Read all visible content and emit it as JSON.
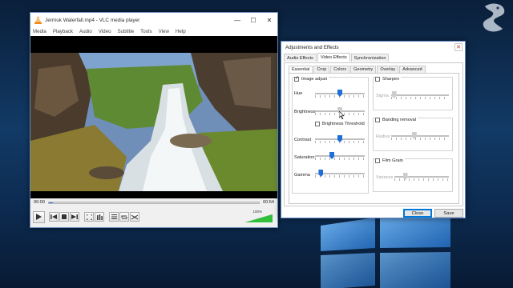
{
  "vlc": {
    "title": "Jermuk Waterfall.mp4 - VLC media player",
    "window_buttons": [
      "—",
      "☐",
      "✕"
    ],
    "menu": [
      "Media",
      "Playback",
      "Audio",
      "Video",
      "Subtitle",
      "Tools",
      "View",
      "Help"
    ],
    "time_elapsed": "00:00",
    "time_total": "00:54",
    "seek_progress": 0.02,
    "volume_label": "100%",
    "volume_level": 1.0
  },
  "adjust": {
    "title": "Adjustments and Effects",
    "close": "✕",
    "tabs": [
      "Audio Effects",
      "Video Effects",
      "Synchronization"
    ],
    "active_tab": "Video Effects",
    "subtabs": [
      "Essential",
      "Crop",
      "Colors",
      "Geometry",
      "Overlay",
      "Advanced"
    ],
    "active_subtab": "Essential",
    "image_adjust": {
      "label": "Image adjust",
      "checked": true
    },
    "hue": {
      "label": "Hue",
      "value": 0.5
    },
    "brightness": {
      "label": "Brightness",
      "value": 0.5
    },
    "brightness_threshold": {
      "label": "Brightness Threshold",
      "checked": false
    },
    "contrast": {
      "label": "Contrast",
      "value": 0.5
    },
    "saturation": {
      "label": "Saturation",
      "value": 0.34
    },
    "gamma": {
      "label": "Gamma",
      "value": 0.12
    },
    "sharpen": {
      "label": "Sharpen",
      "checked": false,
      "param_label": "Sigma",
      "value": 0.05
    },
    "banding": {
      "label": "Banding removal",
      "checked": false,
      "param_label": "Radius",
      "value": 0.4
    },
    "film_grain": {
      "label": "Film Grain",
      "checked": false,
      "param_label": "Variance",
      "value": 0.2
    },
    "close_button": "Close",
    "save_button": "Save"
  },
  "colors": {
    "accent": "#1f6fd8",
    "vlc_orange": "#f08c1a",
    "desktop": "#123a66"
  }
}
